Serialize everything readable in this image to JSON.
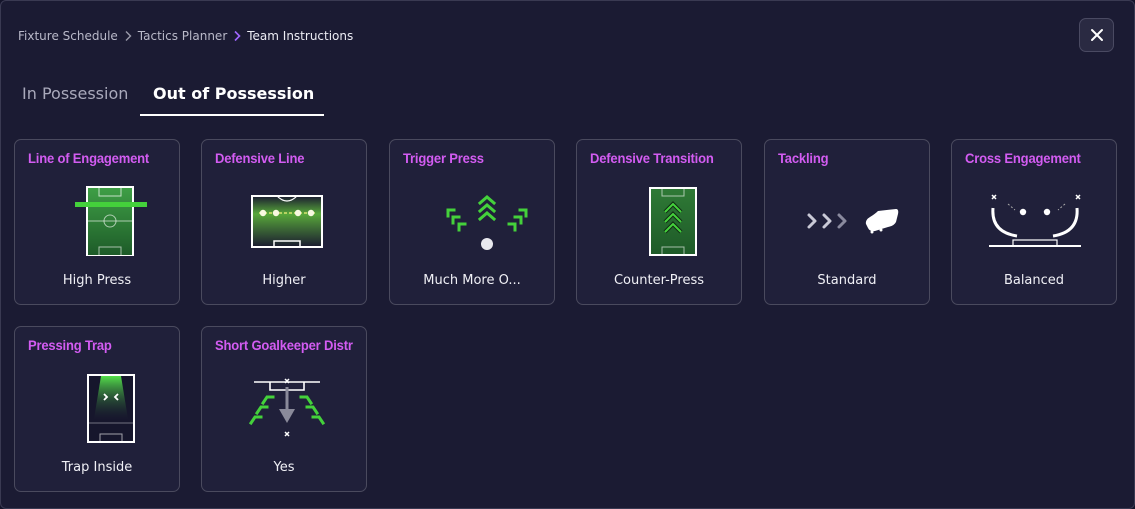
{
  "breadcrumb": {
    "items": [
      "Fixture Schedule",
      "Tactics Planner",
      "Team Instructions"
    ]
  },
  "tabs": [
    {
      "label": "In Possession",
      "active": false
    },
    {
      "label": "Out of Possession",
      "active": true
    }
  ],
  "colors": {
    "accent_title": "#d35cf2",
    "pitch_green": "#2f8a3a",
    "highlight_green": "#44d13b",
    "panel_bg": "#1b1b33",
    "card_bg": "#20203a"
  },
  "cards": [
    {
      "title": "Line of Engagement",
      "value": "High Press",
      "icon": "line-of-engagement-icon"
    },
    {
      "title": "Defensive Line",
      "value": "Higher",
      "icon": "defensive-line-icon"
    },
    {
      "title": "Trigger Press",
      "value": "Much More O...",
      "icon": "trigger-press-icon"
    },
    {
      "title": "Defensive Transition",
      "value": "Counter-Press",
      "icon": "defensive-transition-icon"
    },
    {
      "title": "Tackling",
      "value": "Standard",
      "icon": "tackling-boot-icon"
    },
    {
      "title": "Cross Engagement",
      "value": "Balanced",
      "icon": "cross-engagement-icon"
    },
    {
      "title": "Pressing Trap",
      "value": "Trap Inside",
      "icon": "pressing-trap-icon"
    },
    {
      "title": "Short Goalkeeper Distr",
      "value": "Yes",
      "icon": "short-goalkeeper-distribution-icon"
    }
  ]
}
